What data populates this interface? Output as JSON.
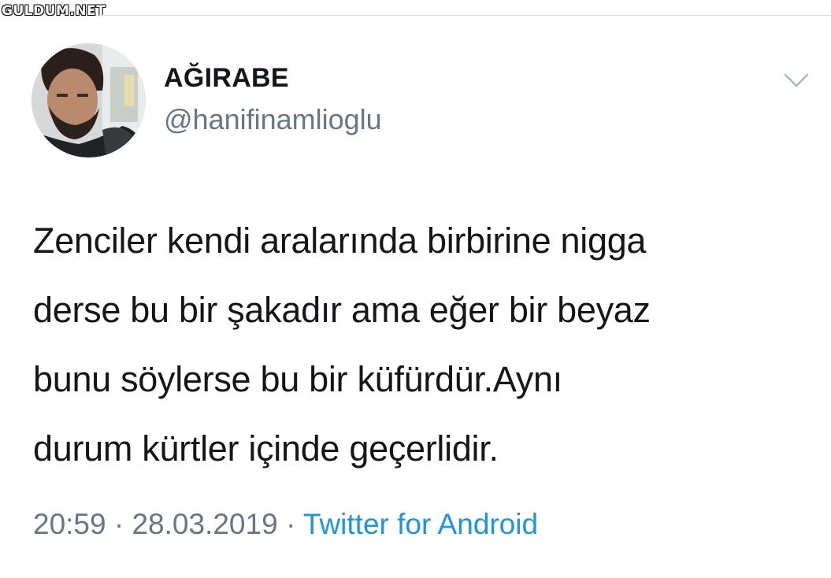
{
  "watermark": "GULDUM.NET",
  "user": {
    "display_name": "AĞIRABE",
    "handle": "@hanifinamlioglu"
  },
  "tweet": {
    "text": "Zenciler kendi aralarında birbirine nigga\nderse bu bir şakadır ama eğer bir beyaz\nbunu söylerse bu bir küfürdür.Aynı\ndurum kürtler içinde geçerlidir."
  },
  "meta": {
    "time": "20:59",
    "separator": "·",
    "date": "28.03.2019",
    "source": "Twitter for Android"
  },
  "icons": {
    "menu_caret": "chevron-down-icon"
  },
  "colors": {
    "text": "#14171a",
    "secondary": "#657786",
    "link": "#1b95e0",
    "background": "#ffffff"
  }
}
